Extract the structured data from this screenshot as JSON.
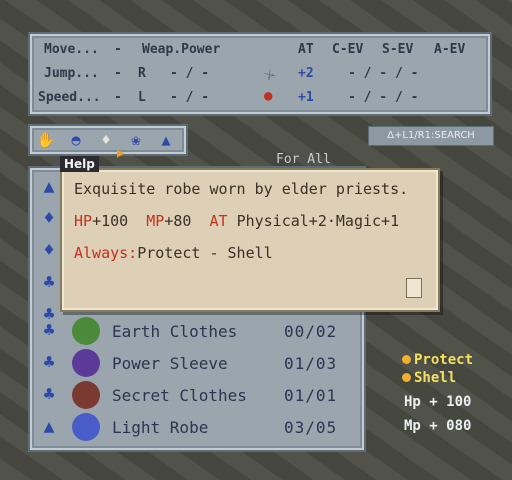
{
  "stats": {
    "move_label": "Move...",
    "move_value": "-",
    "jump_label": "Jump...",
    "jump_value": "R",
    "speed_label": "Speed...",
    "speed_value": "L",
    "weap_power": "Weap.Power",
    "dash_r": "- /  -",
    "dash_l": "- /  -",
    "headers": [
      "AT",
      "C-EV",
      "S-EV",
      "A-EV"
    ],
    "row1_at": "+2",
    "row2_at": "+1",
    "row1_rest": "-  /  -  /  -",
    "row2_rest": "-  /  -  /  -"
  },
  "tabs": [
    "hand-icon",
    "helmet-icon",
    "armor-icon",
    "accessory-icon",
    "bag-icon"
  ],
  "hint": "Δ+L1/R1:SEARCH",
  "for_all": "For All",
  "help": {
    "title": "Help",
    "desc": "Exquisite robe worn by elder priests.",
    "hp_label": "HP",
    "hp_value": "+100",
    "mp_label": "MP",
    "mp_value": "+80",
    "at_label": "AT",
    "at_value": "Physical+2·Magic+1",
    "always_label": "Always:",
    "always_value": "Protect - Shell"
  },
  "items": [
    {
      "name": "Earth Clothes",
      "qty": "00/02",
      "color": "#4a8a3a"
    },
    {
      "name": "Power Sleeve",
      "qty": "01/03",
      "color": "#5c3a9a"
    },
    {
      "name": "Secret Clothes",
      "qty": "01/01",
      "color": "#7a3a32"
    },
    {
      "name": "Light Robe",
      "qty": "03/05",
      "color": "#4a5cc8"
    }
  ],
  "status": {
    "protect": "Protect",
    "shell": "Shell",
    "hp_label": "Hp",
    "hp_value": "+ 100",
    "mp_label": "Mp",
    "mp_value": "+ 080"
  }
}
